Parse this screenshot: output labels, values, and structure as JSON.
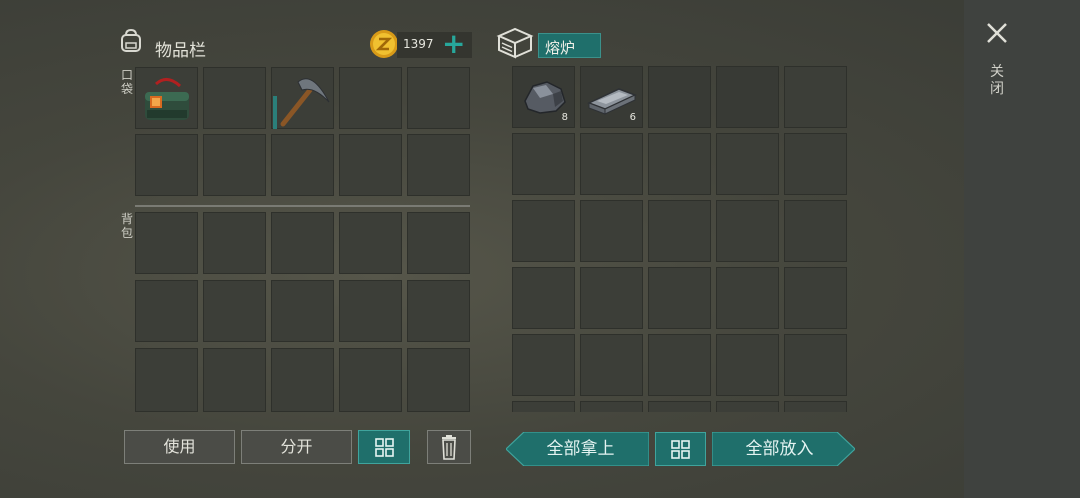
{
  "inventory": {
    "title": "物品栏",
    "pocket_label": "口袋",
    "backpack_label": "背包",
    "coins": "1397",
    "add_coins": "+"
  },
  "furnace": {
    "title": "熔炉",
    "items": [
      {
        "name": "iron-ore",
        "count": "8"
      },
      {
        "name": "iron-ingot",
        "count": "6"
      }
    ]
  },
  "close": {
    "icon": "close-icon",
    "label": "关闭"
  },
  "buttons": {
    "use": "使用",
    "split": "分开",
    "take_all": "全部拿上",
    "put_all": "全部放入"
  },
  "colors": {
    "accent_teal": "#1f6f6b",
    "coin_gold": "#e0a820"
  }
}
